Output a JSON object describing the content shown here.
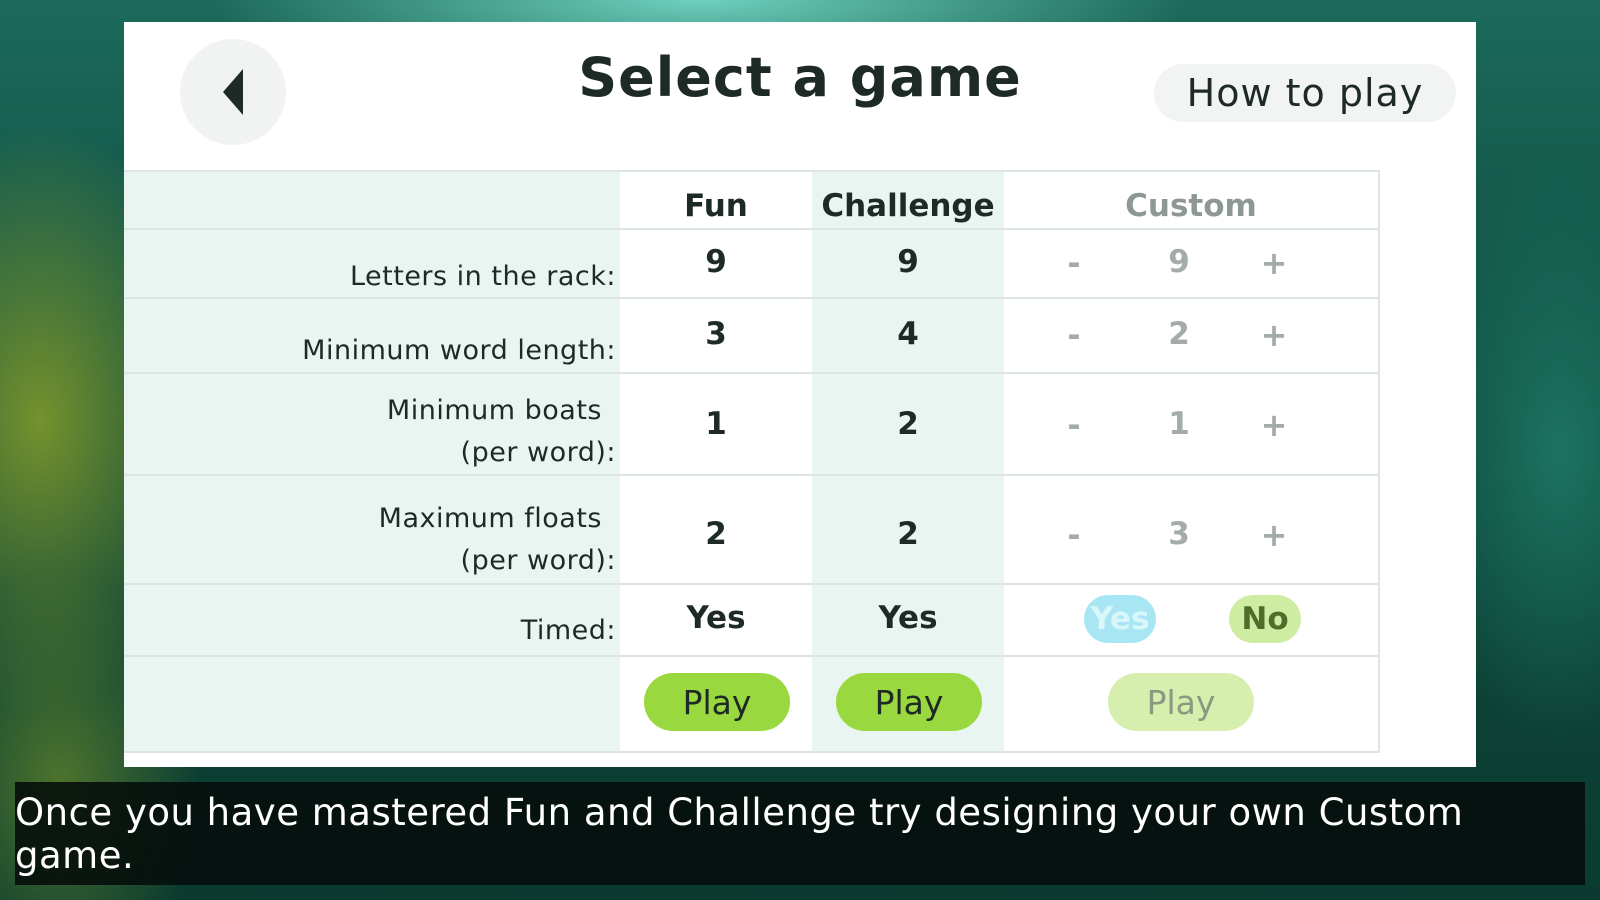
{
  "header": {
    "title": "Select a game",
    "how_to_play": "How to play",
    "back_icon": "back-arrow-icon"
  },
  "columns": {
    "fun": "Fun",
    "challenge": "Challenge",
    "custom": "Custom"
  },
  "rows": {
    "letters": {
      "label": "Letters in the rack:",
      "fun": "9",
      "challenge": "9",
      "custom": "9"
    },
    "min_word": {
      "label": "Minimum word length:",
      "fun": "3",
      "challenge": "4",
      "custom": "2"
    },
    "min_boats": {
      "label_line1": "Minimum boats",
      "label_line2": "(per word):",
      "fun": "1",
      "challenge": "2",
      "custom": "1"
    },
    "max_floats": {
      "label_line1": "Maximum floats",
      "label_line2": "(per word):",
      "fun": "2",
      "challenge": "2",
      "custom": "3"
    },
    "timed": {
      "label": "Timed:",
      "fun": "Yes",
      "challenge": "Yes",
      "custom_yes": "Yes",
      "custom_no": "No"
    }
  },
  "stepper": {
    "minus": "-",
    "plus": "+"
  },
  "buttons": {
    "play": "Play"
  },
  "caption": "Once you have mastered Fun and Challenge try designing your own Custom game.",
  "colors": {
    "play_green": "#9ad83f",
    "column_tint": "#e9f5f0",
    "yes_toggle": "#a9e6f3",
    "no_toggle": "#cfeca3"
  }
}
